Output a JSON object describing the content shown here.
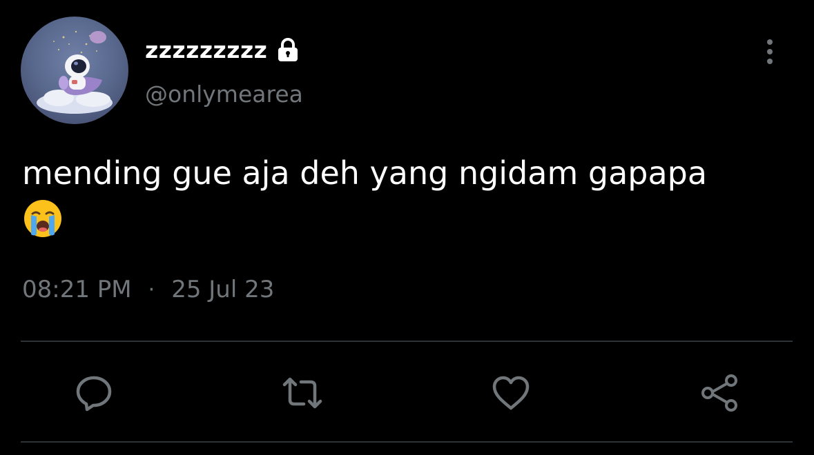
{
  "user": {
    "display_name": "zzzzzzzzz",
    "handle": "@onlymearea",
    "protected_icon": "lock-icon",
    "avatar": "avatar"
  },
  "tweet": {
    "text": "mending gue aja deh yang ngidam gapapa",
    "emoji": "loudly-crying-face-emoji"
  },
  "meta": {
    "time": "08:21 PM",
    "separator": "·",
    "date": "25 Jul 23"
  },
  "actions": {
    "reply_icon": "reply-icon",
    "retweet_icon": "retweet-icon",
    "like_icon": "like-icon",
    "share_icon": "share-icon"
  },
  "header": {
    "more_icon": "more-vertical-icon"
  },
  "colors": {
    "background": "#000000",
    "primary_text": "#ffffff",
    "secondary_text": "#71767b",
    "divider": "#2f3336",
    "icon": "#71767b"
  }
}
